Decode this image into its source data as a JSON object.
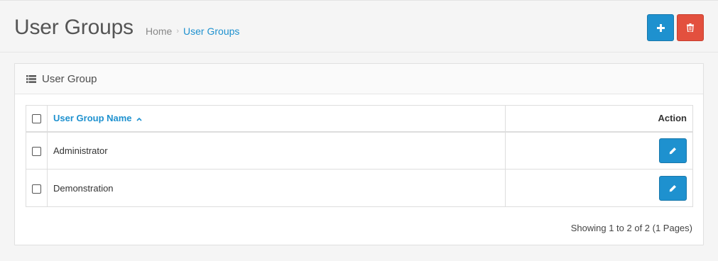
{
  "header": {
    "title": "User Groups",
    "breadcrumb": [
      {
        "label": "Home"
      },
      {
        "label": "User Groups"
      }
    ],
    "breadcrumb_separator": "›",
    "add_icon": "plus-icon",
    "delete_icon": "trash-icon"
  },
  "panel": {
    "title": "User Group",
    "icon": "list-icon"
  },
  "table": {
    "columns": {
      "name": "User Group Name",
      "sort_indicator": "^",
      "action": "Action"
    },
    "rows": [
      {
        "name": "Administrator"
      },
      {
        "name": "Demonstration"
      }
    ],
    "edit_icon": "pencil-icon"
  },
  "pagination": {
    "text": "Showing 1 to 2 of 2 (1 Pages)"
  },
  "colors": {
    "primary": "#1e91cf",
    "danger": "#e3503e",
    "background": "#f5f5f5"
  }
}
